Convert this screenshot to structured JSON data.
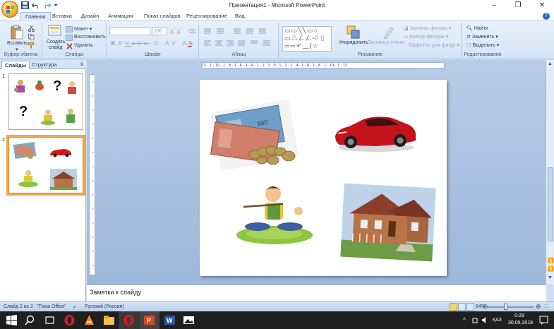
{
  "window": {
    "title": "Презентация1 - Microsoft PowerPoint"
  },
  "tabs": [
    {
      "label": "Главная",
      "active": true
    },
    {
      "label": "Вставка"
    },
    {
      "label": "Дизайн"
    },
    {
      "label": "Анимация"
    },
    {
      "label": "Показ слайдов"
    },
    {
      "label": "Рецензирование"
    },
    {
      "label": "Вид"
    }
  ],
  "ribbon": {
    "clipboard": {
      "paste": "Вставить",
      "label": "Буфер обмена"
    },
    "slides": {
      "create": "Создать",
      "create2": "слайд",
      "layout": "Макет",
      "restore": "Восстановить",
      "delete": "Удалить",
      "label": "Слайды"
    },
    "font": {
      "size": "166",
      "label": "Шрифт"
    },
    "paragraph": {
      "label": "Абзац"
    },
    "drawing": {
      "arrange": "Упорядочить",
      "quick_styles": "Экспресс-стили",
      "fill": "Заливка фигуры",
      "outline": "Контур фигуры",
      "effects": "Эффекты для фигур",
      "label": "Рисование"
    },
    "editing": {
      "find": "Найти",
      "replace": "Заменить",
      "select": "Выделить",
      "label": "Редактирование"
    }
  },
  "left_panel": {
    "tab_slides": "Слайды",
    "tab_outline": "Структура",
    "close": "x",
    "thumbnails": [
      {
        "number": "1",
        "marks": [
          "?",
          "?"
        ]
      },
      {
        "number": "2",
        "selected": true
      }
    ]
  },
  "ruler": {
    "horizontal": "12 · 1 · 10 · 1 · 8 · 1 · 6 · 1 · 4 · 1 · 2 · 1 · 0 · 1 · 2 · 1 · 4 · 1 · 6 · 1 · 8 · 1 · 10 · 1 · 12"
  },
  "notes": {
    "placeholder": "Заметки к слайду"
  },
  "status": {
    "slide": "Слайд 2 из 2",
    "theme": "\"Тема Office\"",
    "language": "Русский (Россия)",
    "zoom": "64%",
    "zoom_level": 0.4
  },
  "taskbar": {
    "lang": "ҚАЗ",
    "time": "0:29",
    "date": "30.05.2018"
  },
  "colors": {
    "slide_bg": "#ffffff",
    "workspace": "#a9c1e1",
    "selection": "#f1a74a",
    "taskbar": "#1f1f1f"
  }
}
